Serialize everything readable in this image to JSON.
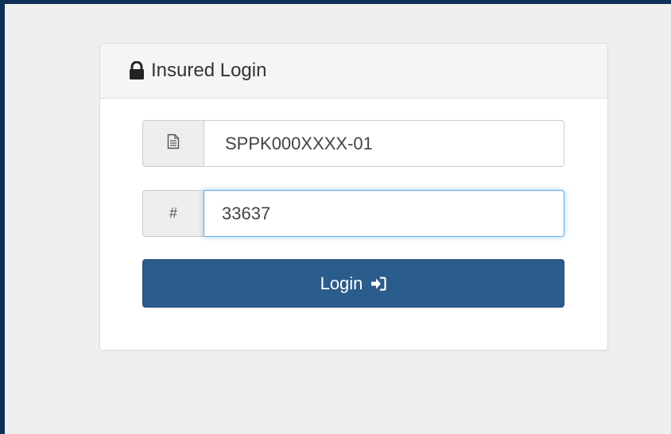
{
  "panel": {
    "title": "Insured Login",
    "title_icon": "lock-icon"
  },
  "policy_field": {
    "addon_icon": "document-icon",
    "value": "SPPK000XXXX-01"
  },
  "pin_field": {
    "addon_label": "#",
    "value": "33637",
    "focused": true
  },
  "login_button": {
    "label": "Login",
    "icon": "log-in-icon"
  },
  "colors": {
    "frame_border": "#0e3057",
    "background": "#efefef",
    "button": "#2a5c8c",
    "focus_ring": "#66afe9"
  }
}
